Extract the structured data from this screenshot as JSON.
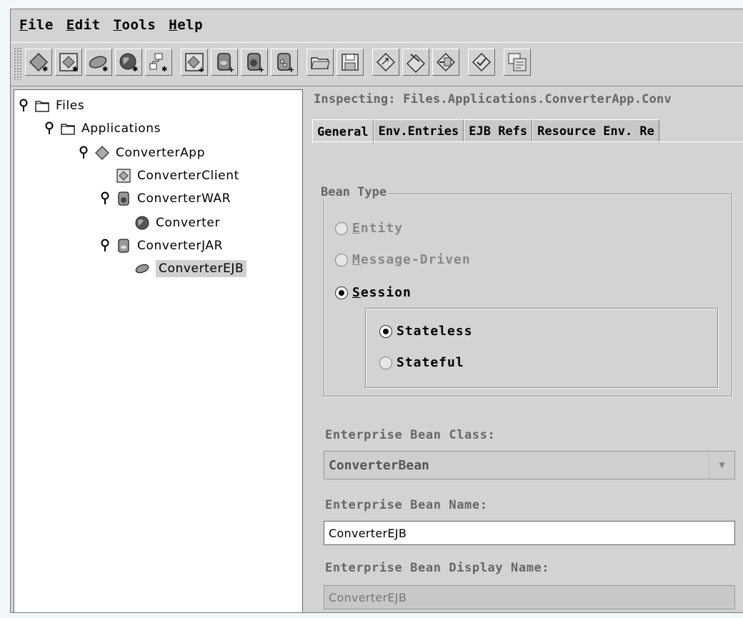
{
  "menubar": {
    "file": {
      "mnemonic": "F",
      "rest": "ile"
    },
    "edit": {
      "mnemonic": "E",
      "rest": "dit"
    },
    "tools": {
      "mnemonic": "T",
      "rest": "ools"
    },
    "help": {
      "mnemonic": "H",
      "rest": "elp"
    }
  },
  "toolbar": {
    "buttons": [
      "new-application-icon",
      "new-application-client-icon",
      "new-enterprise-bean-icon",
      "new-web-component-icon",
      "new-connector-icon",
      "add-to-application-icon",
      "add-jar-icon",
      "add-war-icon",
      "add-rar-icon",
      "open-folder-icon",
      "save-icon",
      "update-files-icon",
      "deploy-icon",
      "undeploy-icon",
      "verify-icon",
      "deployment-tool-icon"
    ]
  },
  "tree": {
    "files": "Files",
    "applications": "Applications",
    "converter_app": "ConverterApp",
    "converter_client": "ConverterClient",
    "converter_war": "ConverterWAR",
    "converter": "Converter",
    "converter_jar": "ConverterJAR",
    "converter_ejb": "ConverterEJB"
  },
  "inspector": {
    "title": "Inspecting: Files.Applications.ConverterApp.Conv",
    "tabs": [
      "General",
      "Env.Entries",
      "EJB Refs",
      "Resource Env. Re"
    ],
    "bean_type_legend": "Bean Type",
    "entity": {
      "mnemonic": "E",
      "rest": "ntity"
    },
    "message_driven": {
      "mnemonic": "M",
      "rest": "essage-Driven"
    },
    "session": {
      "mnemonic": "S",
      "rest": "ession"
    },
    "stateless": "Stateless",
    "stateful": "Stateful",
    "bean_class_label": "Enterprise Bean Class:",
    "bean_class_value": "ConverterBean",
    "bean_name_label": "Enterprise Bean Name:",
    "bean_name_value": "ConverterEJB",
    "display_name_label": "Enterprise Bean Display Name:",
    "display_name_value": "ConverterEJB"
  },
  "colors": {
    "window_bg": "#d3d3d3",
    "tree_bg": "#ffffff",
    "disabled_text": "#888888",
    "selection": "#d0d0d0"
  }
}
